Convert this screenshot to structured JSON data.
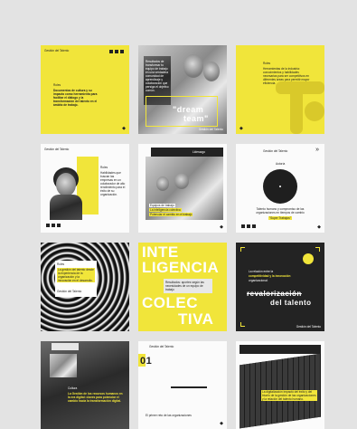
{
  "tiles": {
    "t1": {
      "brand": "Gestión del Talento",
      "tag": "Roles",
      "body": "Documentos de cultura y su impacto como herramienta para facilitar el diálogo y la transformación del talento en el ámbito de trabajo."
    },
    "t2": {
      "body": "Resultados de transformar tu equipo de trabajo en una verdadera comunidad de aprendizaje y colaboración que persiga el objetivo común.",
      "title_line1": "\"dream",
      "title_line2": "team\"",
      "footer": "Gestión del Talento"
    },
    "t3": {
      "tag": "Roles",
      "body": "Herramientas de la industria: conocimientos y habilidades necesarias para ser competitivos en diferentes áreas para permitir mayor eficiencia."
    },
    "t4": {
      "brand": "Gestión del Talento",
      "tag": "Roles",
      "body": "Habilidades que buscan las empresas en un colaborador de alto rendimiento para el éxito de su organización."
    },
    "t5": {
      "tag": "Liderazgo",
      "body_line1": "Equipos de trabajo:",
      "body_line2": "La inteligencia colectiva",
      "body_line3": "Potenciar el cambio en el trabajo"
    },
    "t6": {
      "brand": "Gestión del Talento",
      "chevron": "»",
      "label": "Autoría",
      "caption": "Talento humano y compromiso de las organizaciones en tiempos de cambio",
      "caption2": "\"Super Trabajos\""
    },
    "t7": {
      "tag": "Roles",
      "body": "La gestión del talento desde la experiencia de la organización y la innovación en el desarrollo.",
      "sub": "Gestión del Talento"
    },
    "t8": {
      "word_top_a": "INTE",
      "word_top_b": "LIGENCIA",
      "word_bottom_a": "COLEC",
      "word_bottom_b": "TIVA",
      "note": "Resultados: aportes según las necesidades de un equipo de trabajo"
    },
    "t9": {
      "line1": "La relación entre la",
      "line2": "competitividad y la innovación",
      "line3": "organizacional:",
      "big1": "revalorización",
      "big2": "del talento",
      "footer": "Gestión del Talento"
    },
    "t10": {
      "tag": "Cultura",
      "body": "La Gestión de los recursos humanos en la era digital: claves para potenciar el cambio hacia la transformación digital."
    },
    "t11": {
      "brand": "Gestión del Talento",
      "number": "01",
      "body": "El primer reto de las organizaciones"
    },
    "t12": {
      "body": "La digitalización impactó del éxito y del triunfo de la gestión de las organizaciones y la relación del talento humano."
    }
  }
}
